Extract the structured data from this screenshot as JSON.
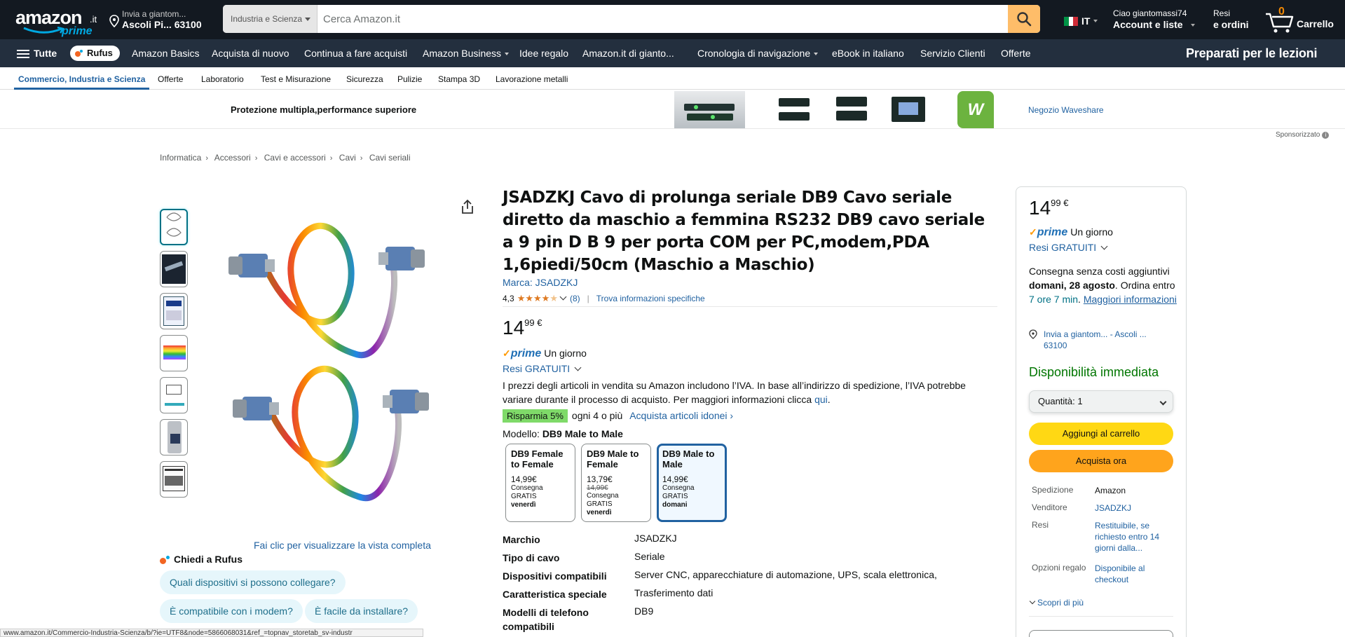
{
  "nav": {
    "logo_word": "amazon",
    "logo_suffix": ".it",
    "logo_prime": "prime",
    "deliver_line1": "Invia a giantom...",
    "deliver_line2": "Ascoli Pi... 63100",
    "search_dept": "Industria e Scienza",
    "search_placeholder": "Cerca Amazon.it",
    "lang": "IT",
    "account_line1": "Ciao giantomassi74",
    "account_line2": "Account e liste",
    "returns_line1": "Resi",
    "returns_line2": "e ordini",
    "cart_count": "0",
    "cart_label": "Carrello"
  },
  "main_nav": {
    "all": "Tutte",
    "rufus": "Rufus",
    "items": [
      "Amazon Basics",
      "Acquista di nuovo",
      "Continua a fare acquisti",
      "Amazon Business",
      "Idee regalo",
      "Amazon.it di gianto...",
      "Cronologia di navigazione",
      "eBook in italiano",
      "Servizio Clienti",
      "Offerte"
    ],
    "promo": "Preparati per le lezioni"
  },
  "subnav": [
    "Commercio, Industria e Scienza",
    "Offerte",
    "Laboratorio",
    "Test e Misurazione",
    "Sicurezza",
    "Pulizie",
    "Stampa 3D",
    "Lavorazione metalli"
  ],
  "banner": {
    "headline": "Protezione multipla,performance superiore",
    "store_link": "Negozio Waveshare",
    "sponsored": "Sponsorizzato"
  },
  "breadcrumb": [
    "Informatica",
    "Accessori",
    "Cavi e accessori",
    "Cavi",
    "Cavi seriali"
  ],
  "product": {
    "title": "JSADZKJ Cavo di prolunga seriale DB9 Cavo seriale diretto da maschio a femmina RS232 DB9 cavo seriale a 9 pin D B 9 per porta COM per PC,modem,PDA 1,6piedi/50cm (Maschio a Maschio)",
    "brand": "Marca: JSADZKJ",
    "rating": "4,3",
    "stars": 4.3,
    "review_count": "(8)",
    "specs_link": "Trova informazioni specifiche",
    "price_whole": "14",
    "price_frac": "99 €",
    "prime_text": "Un giorno",
    "free_returns": "Resi GRATUITI",
    "vat_text": "I prezzi degli articoli in vendita su Amazon includono l’IVA. In base all’indirizzo di spedizione, l’IVA potrebbe variare durante il processo di acquisto. Per maggiori informazioni clicca",
    "vat_link": "qui",
    "save_badge": "Risparmia 5%",
    "save_text": "ogni 4 o più",
    "save_link": "Acquista articoli idonei ›",
    "model_label": "Modello:",
    "model_value": "DB9 Male to Male",
    "view_full": "Fai clic per visualizzare la vista completa"
  },
  "variants": [
    {
      "title": "DB9 Female to Female",
      "price": "14,99€",
      "strike": "",
      "ship": "Consegna GRATIS",
      "day": "venerdì"
    },
    {
      "title": "DB9 Male to Female",
      "price": "13,79€",
      "strike": "14,99€",
      "ship": "Consegna GRATIS",
      "day": "venerdì"
    },
    {
      "title": "DB9 Male to Male",
      "price": "14,99€",
      "strike": "",
      "ship": "Consegna GRATIS",
      "day": "domani"
    }
  ],
  "specs": [
    {
      "k": "Marchio",
      "v": "JSADZKJ"
    },
    {
      "k": "Tipo di cavo",
      "v": "Seriale"
    },
    {
      "k": "Dispositivi compatibili",
      "v": "Server CNC, apparecchiature di automazione, UPS, scala elettronica,"
    },
    {
      "k": "Caratteristica speciale",
      "v": "Trasferimento dati"
    },
    {
      "k": "Modelli di telefono compatibili",
      "v": "DB9"
    }
  ],
  "rufus": {
    "title": "Chiedi a Rufus",
    "chips": [
      "Quali dispositivi si possono collegare?",
      "È compatibile con i modem?",
      "È facile da installare?"
    ]
  },
  "buybox": {
    "price_whole": "14",
    "price_frac": "99 €",
    "prime_text": "Un giorno",
    "free_returns": "Resi GRATUITI",
    "delivery_1": "Consegna senza costi aggiuntivi",
    "delivery_date": "domani, 28 agosto",
    "delivery_2": ". Ordina entro",
    "delivery_time": "7 ore 7 min",
    "delivery_3": ".",
    "more_info": "Maggiori informazioni",
    "ship_to": "Invia a giantom... - Ascoli ... 63100",
    "availability": "Disponibilità immediata",
    "quantity": "Quantità:  1",
    "add_to_cart": "Aggiungi al carrello",
    "buy_now": "Acquista ora",
    "rows": [
      {
        "k": "Spedizione",
        "v": "Amazon"
      },
      {
        "k": "Venditore",
        "v": "JSADZKJ"
      },
      {
        "k": "Resi",
        "v": "Restituibile, se richiesto entro 14 giorni dalla..."
      },
      {
        "k": "Opzioni regalo",
        "v": "Disponibile al checkout"
      }
    ],
    "more": "Scopri di più"
  },
  "status_url": "www.amazon.it/Commercio-Industria-Scienza/b/?ie=UTF8&node=5866068031&ref_=topnav_storetab_sv-industr"
}
